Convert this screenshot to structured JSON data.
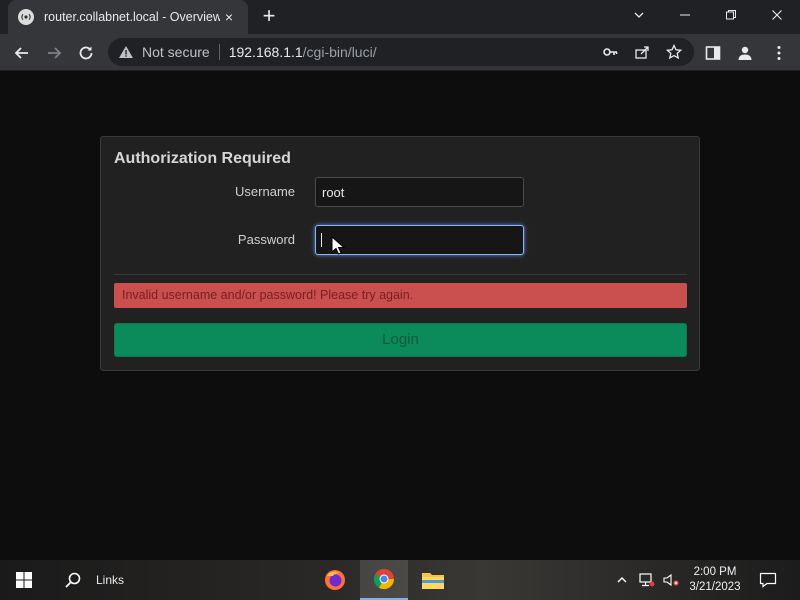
{
  "browser": {
    "tab_title": "router.collabnet.local - Overview",
    "tab_close": "×",
    "new_tab": "+",
    "security_label": "Not secure",
    "url_host": "192.168.1.1",
    "url_path": "/cgi-bin/luci/"
  },
  "login": {
    "title": "Authorization Required",
    "username_label": "Username",
    "username_value": "root",
    "password_label": "Password",
    "password_value": "",
    "error_message": "Invalid username and/or password! Please try again.",
    "login_button": "Login"
  },
  "taskbar": {
    "links_label": "Links",
    "time": "2:00 PM",
    "date": "3/21/2023"
  },
  "colors": {
    "error_background": "#c9504f",
    "login_button": "#0b8b5b",
    "focus_ring": "#8ab4f8"
  },
  "icons": [
    "router-favicon",
    "back-icon",
    "forward-icon",
    "reload-icon",
    "warning-icon",
    "key-icon",
    "share-icon",
    "star-icon",
    "sidebar-icon",
    "profile-icon",
    "menu-icon",
    "windows-start-icon",
    "search-icon",
    "firefox-icon",
    "chrome-icon",
    "file-explorer-icon",
    "chevron-up-icon",
    "network-icon",
    "volume-muted-icon",
    "notification-icon"
  ]
}
